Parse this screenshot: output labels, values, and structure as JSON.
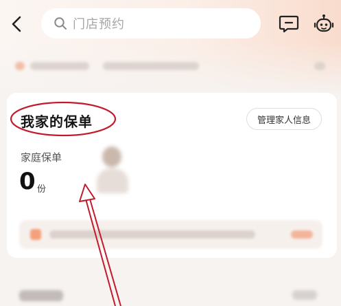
{
  "header": {
    "search_placeholder": "门店预约",
    "icons": [
      "back-arrow-icon",
      "search-icon",
      "message-icon",
      "customer-service-robot-icon"
    ]
  },
  "card": {
    "title": "我家的保单",
    "manage_button_label": "管理家人信息",
    "family_policy_label": "家庭保单",
    "policy_count": "0",
    "policy_count_unit": "份"
  },
  "colors": {
    "annotation": "#c21a2c",
    "header_gradient_end": "#f9dccd"
  }
}
